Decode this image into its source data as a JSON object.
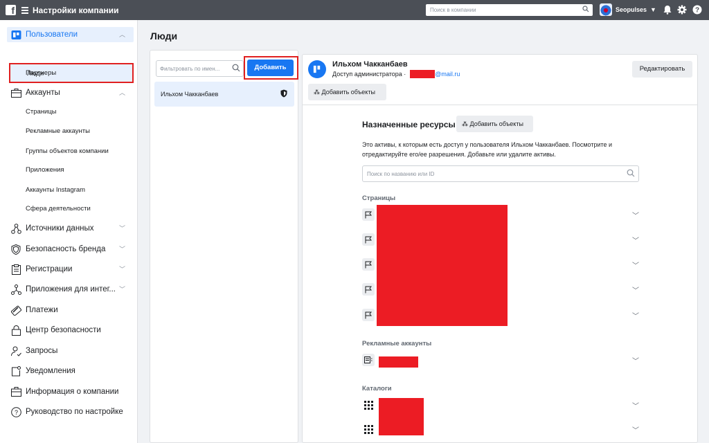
{
  "topbar": {
    "title": "Настройки компании",
    "search_placeholder": "Поиск в компании",
    "account_name": "Seopulses"
  },
  "sidebar": {
    "users": {
      "label": "Пользователи",
      "items": [
        "Люди",
        "Партнеры"
      ]
    },
    "accounts": {
      "label": "Аккаунты",
      "items": [
        "Страницы",
        "Рекламные аккаунты",
        "Группы объектов компании",
        "Приложения",
        "Аккаунты Instagram",
        "Сфера деятельности"
      ]
    },
    "sections": [
      "Источники данных",
      "Безопасность бренда",
      "Регистрации",
      "Приложения для интег...",
      "Платежи",
      "Центр безопасности",
      "Запросы",
      "Уведомления",
      "Информация о компании",
      "Руководство по настройке"
    ]
  },
  "page": {
    "title": "Люди"
  },
  "people_panel": {
    "filter_placeholder": "Фильтровать по имен...",
    "add_label": "Добавить",
    "person_name": "Ильхом Чакканбаев"
  },
  "user_panel": {
    "name": "Ильхом Чакканбаев",
    "role": "Доступ администратора ·",
    "email_domain": "@mail.ru",
    "edit_label": "Редактировать",
    "add_objects_label": "Добавить объекты"
  },
  "resources": {
    "title": "Назначенные ресурсы",
    "add_label": "Добавить объекты",
    "description": "Это активы, к которым есть доступ у пользователя Ильхом Чакканбаев. Посмотрите и отредактируйте его/ее разрешения. Добавьте или удалите активы.",
    "search_placeholder": "Поиск по названию или ID",
    "categories": {
      "pages": "Страницы",
      "ad_accounts": "Рекламные аккаунты",
      "catalogs": "Каталоги"
    }
  },
  "colors": {
    "accent": "#1877f2",
    "topbar": "#4b4f56",
    "redaction": "#ec1c24",
    "highlight_border": "#e02020"
  }
}
